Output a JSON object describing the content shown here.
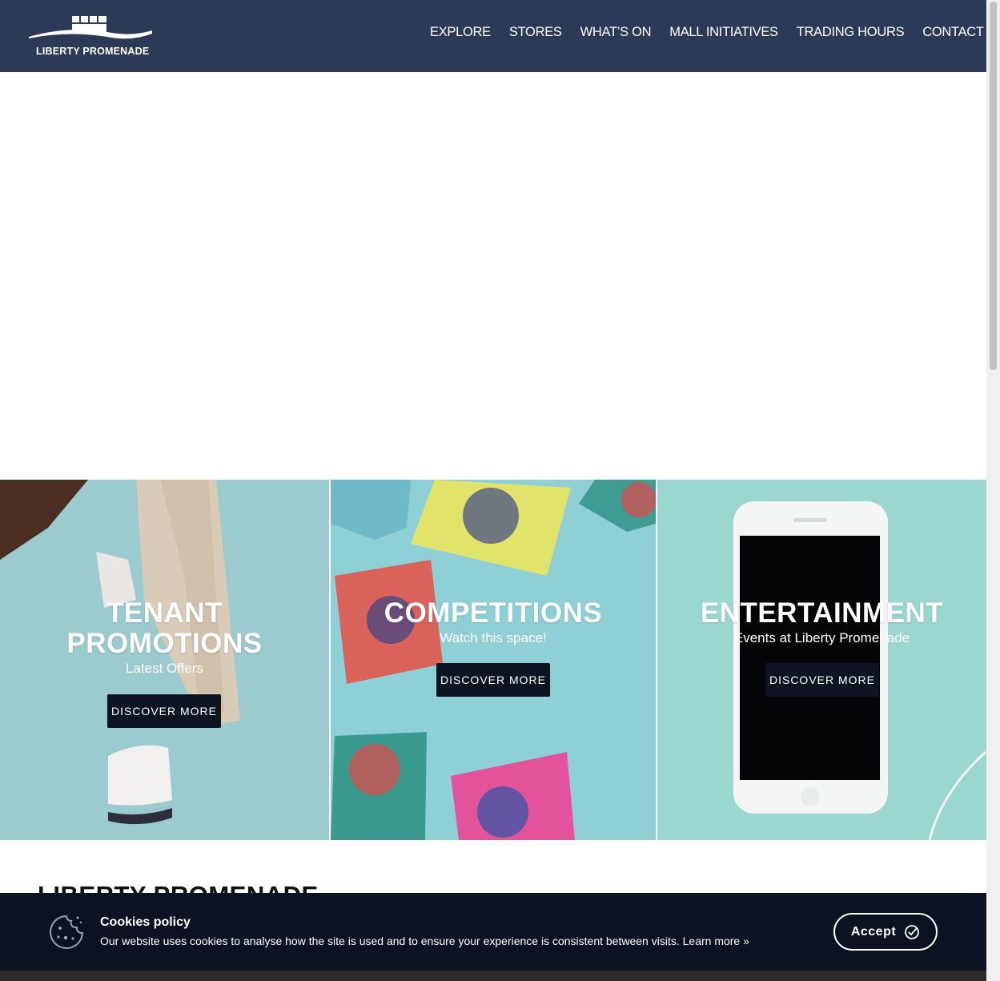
{
  "header": {
    "logo_text": "LIBERTY PROMENADE",
    "nav": [
      "EXPLORE",
      "STORES",
      "WHAT’S ON",
      "MALL INITIATIVES",
      "TRADING HOURS",
      "CONTACT US"
    ]
  },
  "tiles": [
    {
      "title_line1": "TENANT",
      "title_line2": "PROMOTIONS",
      "subtitle": "Latest Offers",
      "button": "DISCOVER MORE"
    },
    {
      "title_line1": "COMPETITIONS",
      "subtitle": "Watch this space!",
      "button": "DISCOVER MORE"
    },
    {
      "title_line1": "ENTERTAINMENT",
      "subtitle": "Events at Liberty Promenade",
      "button": "DISCOVER MORE"
    }
  ],
  "section_title": "LIBERTY PROMENADE",
  "cookie": {
    "title": "Cookies policy",
    "text": "Our website uses cookies to analyse how the site is used and to ensure your experience is consistent between visits.",
    "learn_more": "Learn more »",
    "accept": "Accept"
  },
  "colors": {
    "header_bg": "#2c3a57",
    "button_bg": "#0d1422",
    "cookie_bg": "#0c1222"
  },
  "icons": [
    "logo-icon",
    "cookie-icon",
    "check-circle-icon"
  ]
}
